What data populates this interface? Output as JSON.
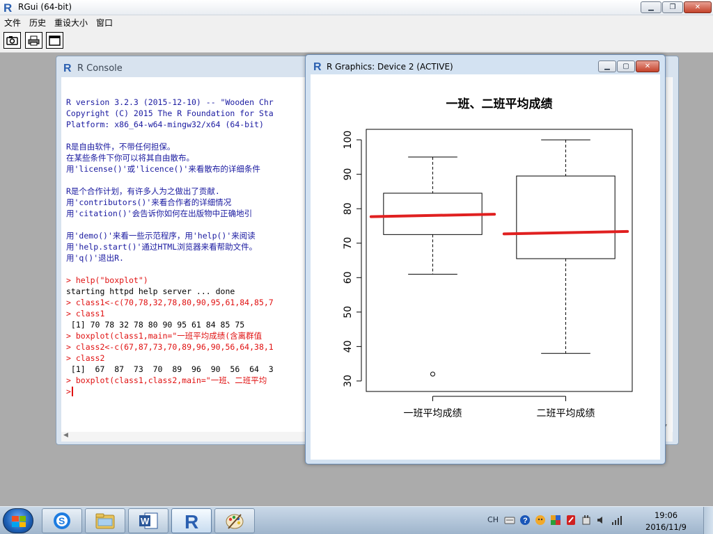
{
  "app": {
    "title": "RGui (64-bit)",
    "menu": [
      "文件",
      "历史",
      "重设大小",
      "窗口"
    ],
    "toolbar_tools": [
      {
        "icon": "open-script-icon"
      },
      {
        "icon": "print-icon"
      },
      {
        "icon": "console-window-icon"
      }
    ]
  },
  "console": {
    "title": "R Console",
    "lines": [
      {
        "k": "out",
        "t": "R version 3.2.3 (2015-12-10) -- \"Wooden Chr"
      },
      {
        "k": "out",
        "t": "Copyright (C) 2015 The R Foundation for Sta"
      },
      {
        "k": "out",
        "t": "Platform: x86_64-w64-mingw32/x64 (64-bit)"
      },
      {
        "k": "blank",
        "t": ""
      },
      {
        "k": "out",
        "t": "R是自由软件，不带任何担保。"
      },
      {
        "k": "out",
        "t": "在某些条件下你可以将其自由散布。"
      },
      {
        "k": "out",
        "t": "用'license()'或'licence()'来看散布的详细条件"
      },
      {
        "k": "blank",
        "t": ""
      },
      {
        "k": "out",
        "t": "R是个合作计划，有许多人为之做出了贡献."
      },
      {
        "k": "out",
        "t": "用'contributors()'来看合作者的详细情况"
      },
      {
        "k": "out",
        "t": "用'citation()'会告诉你如何在出版物中正确地引"
      },
      {
        "k": "blank",
        "t": ""
      },
      {
        "k": "out",
        "t": "用'demo()'来看一些示范程序，用'help()'来阅读"
      },
      {
        "k": "out",
        "t": "用'help.start()'通过HTML浏览器来看帮助文件。"
      },
      {
        "k": "out",
        "t": "用'q()'退出R."
      },
      {
        "k": "blank",
        "t": ""
      },
      {
        "k": "in",
        "t": "> help(\"boxplot\")"
      },
      {
        "k": "plain",
        "t": "starting httpd help server ... done"
      },
      {
        "k": "in",
        "t": "> class1<-c(70,78,32,78,80,90,95,61,84,85,7"
      },
      {
        "k": "in",
        "t": "> class1"
      },
      {
        "k": "plain",
        "t": " [1] 70 78 32 78 80 90 95 61 84 85 75"
      },
      {
        "k": "in",
        "t": "> boxplot(class1,main=\"一班平均成绩(含离群值"
      },
      {
        "k": "in",
        "t": "> class2<-c(67,87,73,70,89,96,90,56,64,38,1"
      },
      {
        "k": "in",
        "t": "> class2"
      },
      {
        "k": "plain",
        "t": " [1]  67  87  73  70  89  96  90  56  64  3"
      },
      {
        "k": "in",
        "t": "> boxplot(class1,class2,main=\"一班、二班平均"
      }
    ],
    "prompt": ">"
  },
  "graphics": {
    "title": "R Graphics: Device 2 (ACTIVE)"
  },
  "chart_data": {
    "type": "box",
    "title": "一班、二班平均成绩",
    "categories": [
      "一班平均成绩",
      "二班平均成绩"
    ],
    "boxes": [
      {
        "min": 61,
        "q1": 72.5,
        "median": 78,
        "q3": 84.5,
        "max": 95,
        "outliers": [
          32
        ]
      },
      {
        "min": 38,
        "q1": 65.5,
        "median": 73,
        "q3": 89.5,
        "max": 100,
        "outliers": []
      }
    ],
    "ylim": [
      30,
      100
    ],
    "yticks": [
      30,
      40,
      50,
      60,
      70,
      80,
      90,
      100
    ],
    "median_color": "#e02020",
    "grid": false
  },
  "taskbar": {
    "apps": [
      {
        "icon": "sogou-browser-icon"
      },
      {
        "icon": "file-explorer-icon"
      },
      {
        "icon": "word-icon"
      },
      {
        "icon": "r-icon"
      },
      {
        "icon": "paint-icon"
      }
    ],
    "ime": "CH",
    "tray_icons": [
      "keyboard-icon",
      "help-icon",
      "sogou-input-icon",
      "network-app-icon",
      "security-icon",
      "power-icon",
      "volume-icon",
      "signal-icon"
    ],
    "time": "19:06",
    "date": "2016/11/9"
  }
}
